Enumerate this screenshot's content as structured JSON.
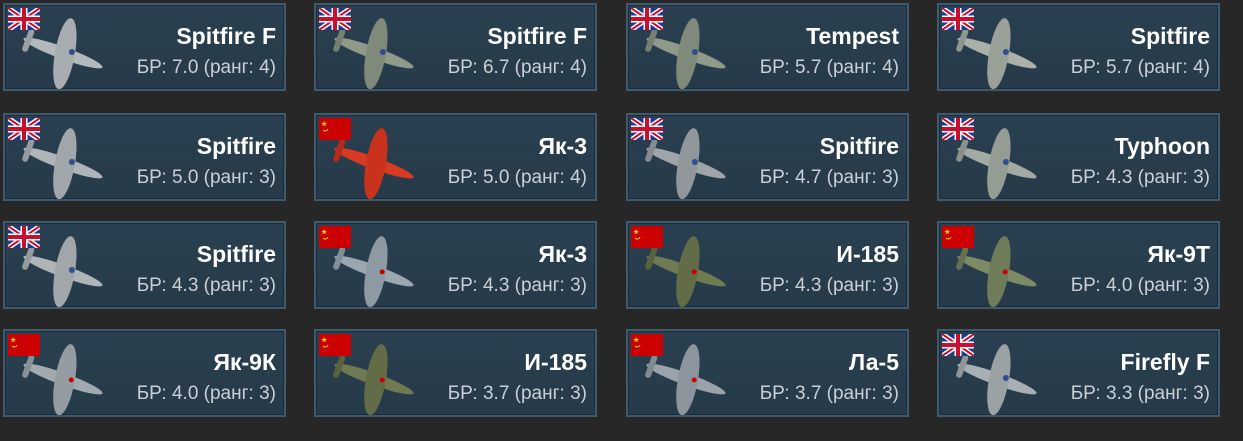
{
  "colors": {
    "background": "#272727",
    "card_bg": "#2a4050",
    "card_border": "#3e5a6e"
  },
  "vehicles": [
    {
      "name": "Spitfire F",
      "br": "БР: 7.0 (ранг: 4)",
      "nation": "uk-flag-icon",
      "plane": "plane-gray-icon"
    },
    {
      "name": "Spitfire F",
      "br": "БР: 6.7 (ранг: 4)",
      "nation": "uk-flag-icon",
      "plane": "plane-gray-icon"
    },
    {
      "name": "Tempest",
      "br": "БР: 5.7 (ранг: 4)",
      "nation": "uk-flag-icon",
      "plane": "plane-gray-icon"
    },
    {
      "name": "Spitfire",
      "br": "БР: 5.7 (ранг: 4)",
      "nation": "uk-flag-icon",
      "plane": "plane-gray-icon"
    },
    {
      "name": "Spitfire",
      "br": "БР: 5.0 (ранг: 3)",
      "nation": "uk-flag-icon",
      "plane": "plane-gray-icon"
    },
    {
      "name": "Як-3",
      "br": "БР: 5.0 (ранг: 4)",
      "nation": "ussr-flag-icon",
      "plane": "plane-red-icon"
    },
    {
      "name": "Spitfire",
      "br": "БР: 4.7 (ранг: 3)",
      "nation": "uk-flag-icon",
      "plane": "plane-gray-icon"
    },
    {
      "name": "Typhoon",
      "br": "БР: 4.3 (ранг: 3)",
      "nation": "uk-flag-icon",
      "plane": "plane-gray-icon"
    },
    {
      "name": "Spitfire",
      "br": "БР: 4.3 (ранг: 3)",
      "nation": "uk-flag-icon",
      "plane": "plane-gray-icon"
    },
    {
      "name": "Як-3",
      "br": "БР: 4.3 (ранг: 3)",
      "nation": "ussr-flag-icon",
      "plane": "plane-gray-icon"
    },
    {
      "name": "И-185",
      "br": "БР: 4.3 (ранг: 3)",
      "nation": "ussr-flag-icon",
      "plane": "plane-olive-icon"
    },
    {
      "name": "Як-9Т",
      "br": "БР: 4.0 (ранг: 3)",
      "nation": "ussr-flag-icon",
      "plane": "plane-olive-icon"
    },
    {
      "name": "Як-9К",
      "br": "БР: 4.0 (ранг: 3)",
      "nation": "ussr-flag-icon",
      "plane": "plane-gray-icon"
    },
    {
      "name": "И-185",
      "br": "БР: 3.7 (ранг: 3)",
      "nation": "ussr-flag-icon",
      "plane": "plane-olive-icon"
    },
    {
      "name": "Ла-5",
      "br": "БР: 3.7 (ранг: 3)",
      "nation": "ussr-flag-icon",
      "plane": "plane-gray-icon"
    },
    {
      "name": "Firefly F",
      "br": "БР: 3.3 (ранг: 3)",
      "nation": "uk-flag-icon",
      "plane": "plane-gray-icon"
    }
  ]
}
